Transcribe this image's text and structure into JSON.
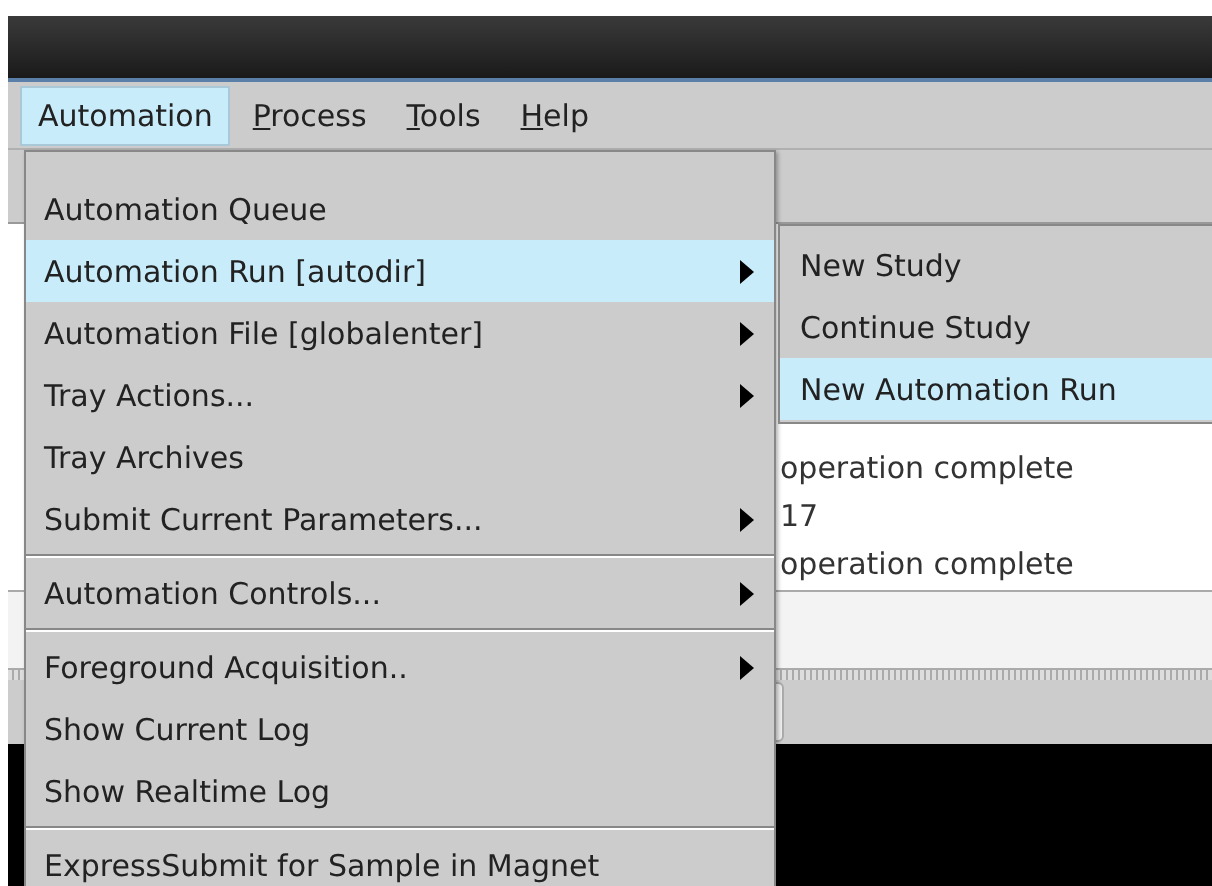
{
  "menu_bar": [
    {
      "label": "Automation",
      "selected": true,
      "mnemonic_underlined": false
    },
    {
      "label": "Process",
      "selected": false,
      "mnemonic_underlined": true
    },
    {
      "label": "Tools",
      "selected": false,
      "mnemonic_underlined": true
    },
    {
      "label": "Help",
      "selected": false,
      "mnemonic_underlined": true
    }
  ],
  "menu": {
    "items": [
      {
        "kind": "item",
        "label": "Automation Queue",
        "has_submenu": false,
        "selected": false
      },
      {
        "kind": "item",
        "label": "Automation Run [autodir]",
        "has_submenu": true,
        "selected": true
      },
      {
        "kind": "item",
        "label": "Automation File [globalenter]",
        "has_submenu": true,
        "selected": false
      },
      {
        "kind": "item",
        "label": "Tray Actions...",
        "has_submenu": true,
        "selected": false
      },
      {
        "kind": "item",
        "label": "Tray Archives",
        "has_submenu": false,
        "selected": false
      },
      {
        "kind": "item",
        "label": "Submit Current Parameters...",
        "has_submenu": true,
        "selected": false
      },
      {
        "kind": "separator"
      },
      {
        "kind": "item",
        "label": "Automation Controls...",
        "has_submenu": true,
        "selected": false
      },
      {
        "kind": "separator"
      },
      {
        "kind": "item",
        "label": "Foreground Acquisition..",
        "has_submenu": true,
        "selected": false
      },
      {
        "kind": "item",
        "label": "Show Current Log",
        "has_submenu": false,
        "selected": false
      },
      {
        "kind": "item",
        "label": "Show Realtime Log",
        "has_submenu": false,
        "selected": false
      },
      {
        "kind": "separator"
      },
      {
        "kind": "item",
        "label": "ExpressSubmit for Sample in Magnet",
        "has_submenu": false,
        "selected": false
      }
    ]
  },
  "submenu": {
    "items": [
      {
        "label": "New Study",
        "selected": false
      },
      {
        "label": "Continue Study",
        "selected": false
      },
      {
        "label": "New Automation Run",
        "selected": true
      }
    ]
  },
  "log": {
    "lines": [
      "operation complete",
      "17",
      "operation complete"
    ]
  }
}
